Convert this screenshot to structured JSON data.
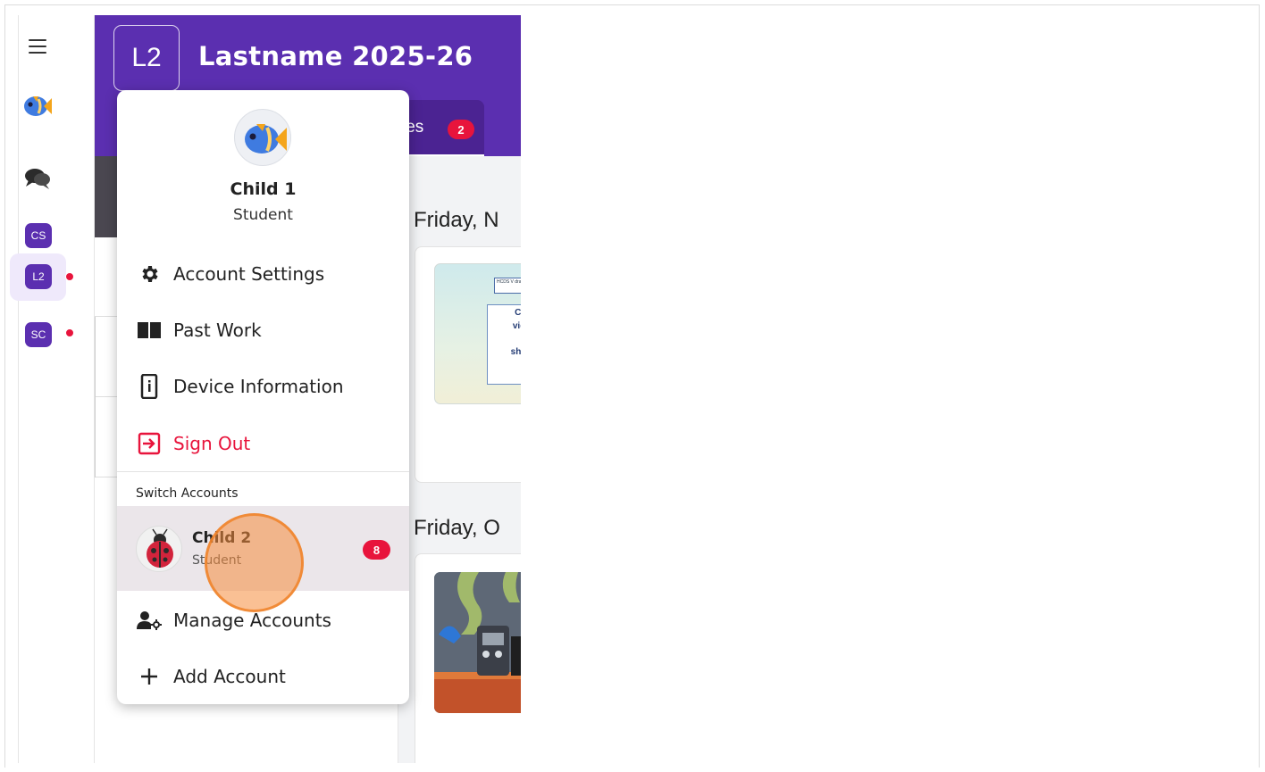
{
  "header": {
    "class_code": "L2",
    "title": "Lastname 2025-26",
    "tab_partial_label": "ies",
    "tab_badge": "2"
  },
  "rail": {
    "items": [
      {
        "name": "chat"
      },
      {
        "code": "CS"
      },
      {
        "code": "L2",
        "active": true,
        "notification": true
      },
      {
        "code": "SC",
        "notification": true
      }
    ]
  },
  "feed": {
    "date_1": "Friday, N",
    "date_2": "Friday, O",
    "card_1_label_lines": "HCDS V\ndrawing",
    "card_1_text": "Click\nvideo\nCa\nshowi\nus\nD"
  },
  "account_menu": {
    "current_user": {
      "name": "Child 1",
      "role": "Student"
    },
    "items": [
      {
        "label": "Account Settings",
        "icon": "gear-icon"
      },
      {
        "label": "Past Work",
        "icon": "book-icon"
      },
      {
        "label": "Device Information",
        "icon": "device-info-icon"
      },
      {
        "label": "Sign Out",
        "icon": "sign-out-icon"
      }
    ],
    "switch_heading": "Switch Accounts",
    "switch_account": {
      "name": "Child 2",
      "role": "Student",
      "badge": "8"
    },
    "manage_label": "Manage Accounts",
    "add_label": "Add Account"
  },
  "colors": {
    "brand_purple": "#5b2fb0",
    "alert_red": "#e8143c",
    "click_highlight": "#f58c3c"
  }
}
